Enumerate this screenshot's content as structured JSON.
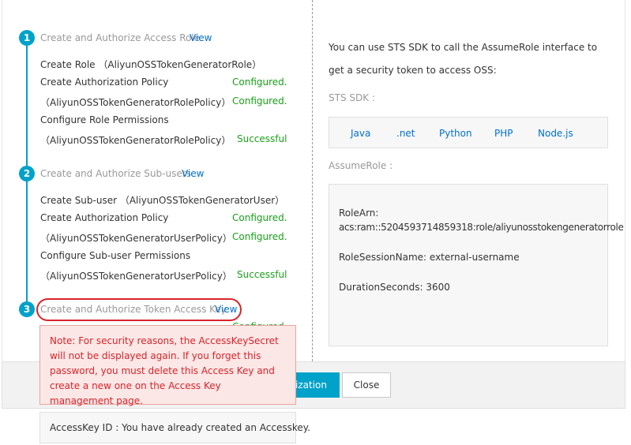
{
  "steps": [
    {
      "number": "1",
      "title": "Create and Authorize Access Role",
      "view_label": "View",
      "rows": [
        {
          "text": "Create Role （AliyunOSSTokenGeneratorRole）",
          "status": ""
        },
        {
          "text": "Create Authorization Policy",
          "status": "Configured."
        },
        {
          "text": "（AliyunOSSTokenGeneratorRolePolicy）",
          "status": "Configured."
        },
        {
          "text": "Configure Role Permissions",
          "status": ""
        },
        {
          "text": "（AliyunOSSTokenGeneratorRolePolicy）",
          "status": "Successful"
        }
      ]
    },
    {
      "number": "2",
      "title": "Create and Authorize Sub-users",
      "view_label": "View",
      "rows": [
        {
          "text": "Create Sub-user （AliyunOSSTokenGeneratorUser）",
          "status": ""
        },
        {
          "text": "Create Authorization Policy",
          "status": "Configured."
        },
        {
          "text": "（AliyunOSSTokenGeneratorUserPolicy）",
          "status": "Configured."
        },
        {
          "text": "Configure Sub-user Permissions",
          "status": ""
        },
        {
          "text": "（AliyunOSSTokenGeneratorUserPolicy）",
          "status": "Successful"
        }
      ]
    },
    {
      "number": "3",
      "title": "Create and Authorize Token Access Key",
      "view_label": "View",
      "status": "Configured."
    }
  ],
  "right": {
    "intro": "You can use STS SDK to call the AssumeRole interface to get a security token to access OSS:",
    "sdk_label": "STS SDK :",
    "sdk_links": [
      "Java",
      ".net",
      "Python",
      "PHP",
      "Node.js"
    ],
    "assume_label": "AssumeRole :",
    "role_arn_label": "RoleArn:",
    "role_arn_value": "acs:ram::5204593714859318:role/aliyunosstokengeneratorrole",
    "session_name": "RoleSessionName: external-username",
    "duration": "DurationSeconds: 3600"
  },
  "footer": {
    "primary_label": "rization",
    "close_label": "Close"
  },
  "note": {
    "text": "Note: For security reasons, the AccessKeySecret will not be displayed again. If you forget this password, you must delete this Access Key and create a new one on the Access Key management page."
  },
  "keyid": {
    "text": "AccessKey ID : You have already created an Accesskey."
  },
  "colors": {
    "accent": "#00a2ca",
    "link": "#0070cc",
    "success": "#1aa01a",
    "error": "#d9242a"
  }
}
